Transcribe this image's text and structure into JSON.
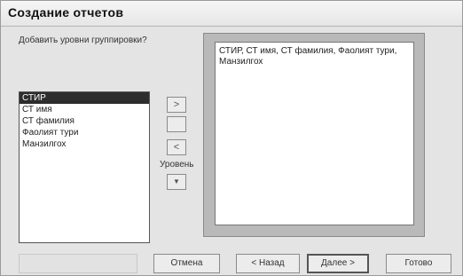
{
  "window": {
    "title": "Создание отчетов"
  },
  "grouping": {
    "prompt": "Добавить уровни группировки?",
    "fields": [
      {
        "label": "СТИР",
        "selected": true
      },
      {
        "label": "СТ имя",
        "selected": false
      },
      {
        "label": "СТ фамилия",
        "selected": false
      },
      {
        "label": "Фаолият тури",
        "selected": false
      },
      {
        "label": "Манзилгох",
        "selected": false
      }
    ],
    "level_label": "Уровень",
    "buttons": {
      "add": ">",
      "add_all": "",
      "remove": "<",
      "down": "▼"
    }
  },
  "preview": {
    "text": "СТИР, СТ имя, СТ фамилия, Фаолият тури, Манзилгох"
  },
  "footer": {
    "cancel": "Отмена",
    "back": "< Назад",
    "next": "Далее >",
    "finish": "Готово"
  }
}
